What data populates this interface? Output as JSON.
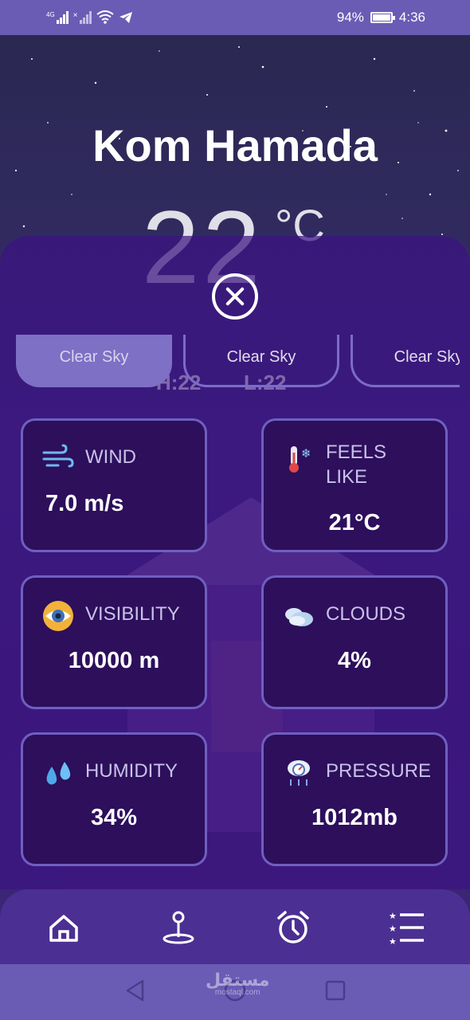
{
  "status_bar": {
    "network_label": "4G",
    "battery": "94%",
    "time": "4:36"
  },
  "weather": {
    "city": "Kom Hamada",
    "temperature": "22",
    "unit": "°C",
    "hi_lo_fragment_a": "H:22",
    "hi_lo_fragment_b": "L:22"
  },
  "forecast_chips": [
    {
      "label": "Clear Sky"
    },
    {
      "label": "Clear Sky"
    },
    {
      "label": "Clear Sky"
    }
  ],
  "details": {
    "wind": {
      "title": "WIND",
      "value": "7.0 m/s"
    },
    "feels_like": {
      "title_line1": "FEELS",
      "title_line2": "LIKE",
      "value": "21°C"
    },
    "visibility": {
      "title": "VISIBILITY",
      "value": "10000 m"
    },
    "clouds": {
      "title": "CLOUDS",
      "value": "4%"
    },
    "humidity": {
      "title": "HUMIDITY",
      "value": "34%"
    },
    "pressure": {
      "title": "PRESSURE",
      "value": "1012mb"
    }
  },
  "watermark": {
    "arabic": "مستقل",
    "latin": "mostaql.com"
  },
  "icons": {
    "nav": [
      "home-icon",
      "location-icon",
      "alarm-icon",
      "list-icon"
    ],
    "system": [
      "back-icon",
      "home-circle-icon",
      "recents-icon"
    ]
  },
  "colors": {
    "status_bar": "#6a5cb5",
    "sheet": "#3c1482",
    "card_bg": "#2d0f5c",
    "card_border": "#6f5fc0",
    "chip_active": "#7e70c4",
    "bottom_nav": "#4b2f92"
  }
}
